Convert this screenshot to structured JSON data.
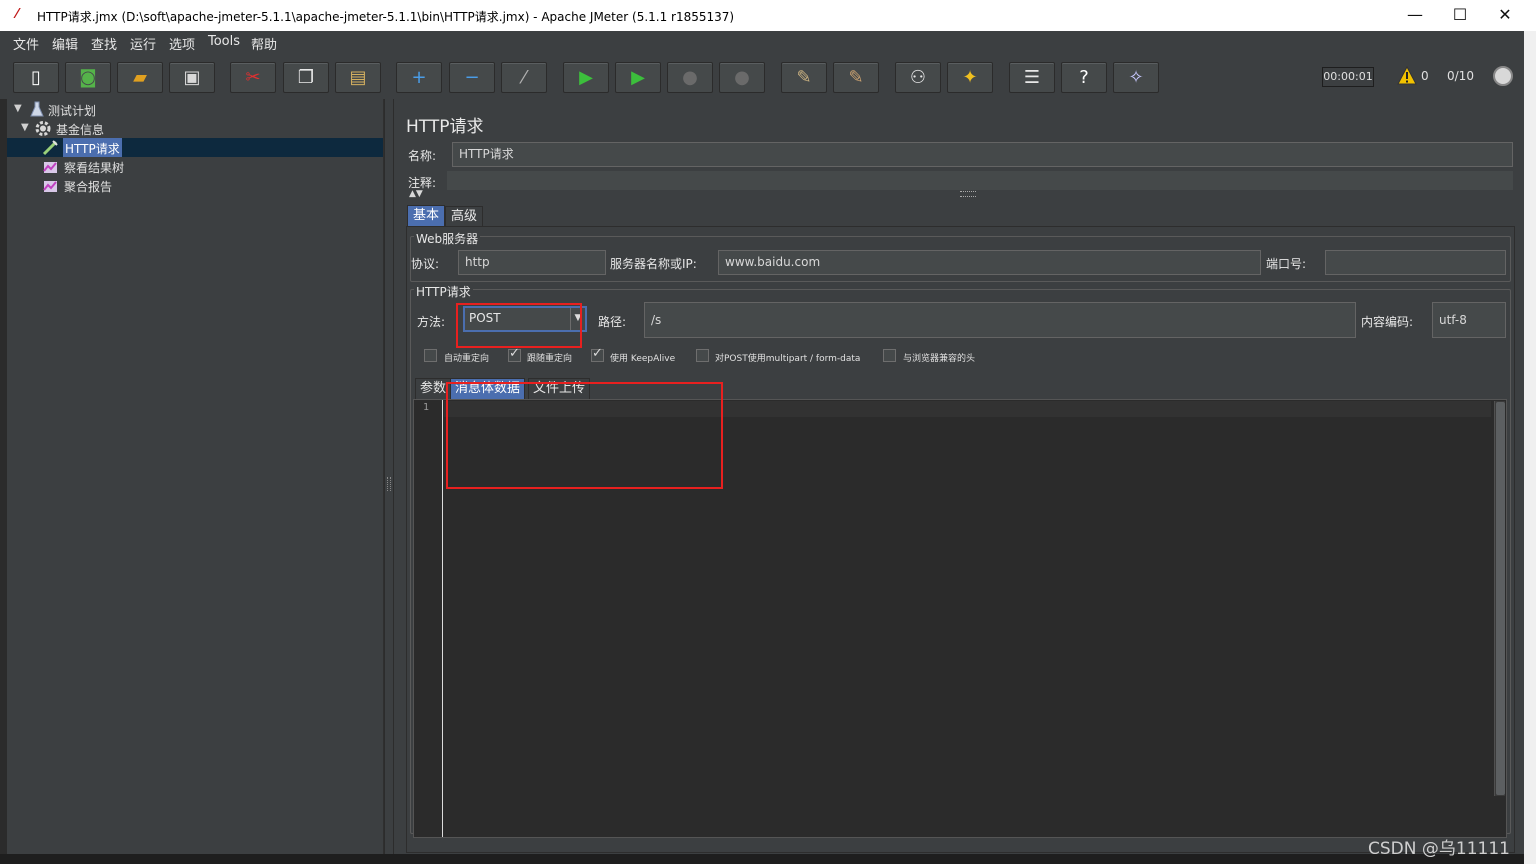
{
  "window": {
    "title": "HTTP请求.jmx (D:\\soft\\apache-jmeter-5.1.1\\apache-jmeter-5.1.1\\bin\\HTTP请求.jmx) - Apache JMeter (5.1.1 r1855137)",
    "minimize": "—",
    "maximize": "☐",
    "close": "✕"
  },
  "menu": [
    "文件",
    "编辑",
    "查找",
    "运行",
    "选项",
    "Tools",
    "帮助"
  ],
  "toolbar": {
    "buttons": [
      {
        "name": "new-icon",
        "glyph": "▯",
        "color": "#ffffff"
      },
      {
        "name": "templates-icon",
        "glyph": "◙",
        "color": "#55b34a"
      },
      {
        "name": "open-icon",
        "glyph": "▰",
        "color": "#e0a020"
      },
      {
        "name": "save-icon",
        "glyph": "▣",
        "color": "#d8d8d8"
      },
      {
        "name": "cut-icon",
        "glyph": "✂",
        "color": "#e03030"
      },
      {
        "name": "copy-icon",
        "glyph": "❐",
        "color": "#e8e8e8"
      },
      {
        "name": "paste-icon",
        "glyph": "▤",
        "color": "#d4b060"
      },
      {
        "name": "expand-icon",
        "glyph": "+",
        "color": "#4a9de8"
      },
      {
        "name": "collapse-icon",
        "glyph": "−",
        "color": "#4a9de8"
      },
      {
        "name": "toggle-icon",
        "glyph": "⁄",
        "color": "#b0b0b0"
      },
      {
        "name": "start-icon",
        "glyph": "▶",
        "color": "#3cbf3c"
      },
      {
        "name": "start-no-pauses-icon",
        "glyph": "▶",
        "color": "#3cbf3c"
      },
      {
        "name": "stop-icon",
        "glyph": "●",
        "color": "#6a6a6a"
      },
      {
        "name": "shutdown-icon",
        "glyph": "●",
        "color": "#6a6a6a"
      },
      {
        "name": "clear-icon",
        "glyph": "✎",
        "color": "#c8b080"
      },
      {
        "name": "clear-all-icon",
        "glyph": "✎",
        "color": "#c8a070"
      },
      {
        "name": "search-icon",
        "glyph": "⚇",
        "color": "#e8e8e8"
      },
      {
        "name": "reset-search-icon",
        "glyph": "✦",
        "color": "#f0c020"
      },
      {
        "name": "function-helper-icon",
        "glyph": "☰",
        "color": "#e8e8e8"
      },
      {
        "name": "help-icon",
        "glyph": "?",
        "color": "#ffffff"
      },
      {
        "name": "remote-icon",
        "glyph": "✧",
        "color": "#c8c8ff"
      }
    ],
    "timer": "00:00:01",
    "warnings": "0",
    "threads": "0/10"
  },
  "tree": {
    "items": [
      {
        "label": "测试计划",
        "expander": "▼"
      },
      {
        "label": "基金信息",
        "expander": "▼"
      },
      {
        "label": "HTTP请求",
        "selected": true
      },
      {
        "label": "察看结果树"
      },
      {
        "label": "聚合报告"
      }
    ]
  },
  "panel": {
    "title": "HTTP请求",
    "name_label": "名称:",
    "name_value": "HTTP请求",
    "comment_label": "注释:",
    "tabs": [
      "基本",
      "高级"
    ],
    "web_server": {
      "group_title": "Web服务器",
      "protocol_label": "协议:",
      "protocol_value": "http",
      "server_label": "服务器名称或IP:",
      "server_value": "www.baidu.com",
      "port_label": "端口号:",
      "port_value": ""
    },
    "http_request": {
      "group_title": "HTTP请求",
      "method_label": "方法:",
      "method_value": "POST",
      "path_label": "路径:",
      "path_value": "/s",
      "encoding_label": "内容编码:",
      "encoding_value": "utf-8"
    },
    "checkboxes": [
      {
        "label": "自动重定向",
        "checked": false
      },
      {
        "label": "跟随重定向",
        "checked": true
      },
      {
        "label": "使用 KeepAlive",
        "checked": true
      },
      {
        "label": "对POST使用multipart / form-data",
        "checked": false
      },
      {
        "label": "与浏览器兼容的头",
        "checked": false
      }
    ],
    "inner_tabs": [
      "参数",
      "消息体数据",
      "文件上传"
    ],
    "editor_line": "1"
  },
  "watermark": "CSDN @乌11111",
  "colors": {
    "background": "#3c3f41",
    "selection": "#4b6eaf",
    "annotation": "#e8201f"
  }
}
